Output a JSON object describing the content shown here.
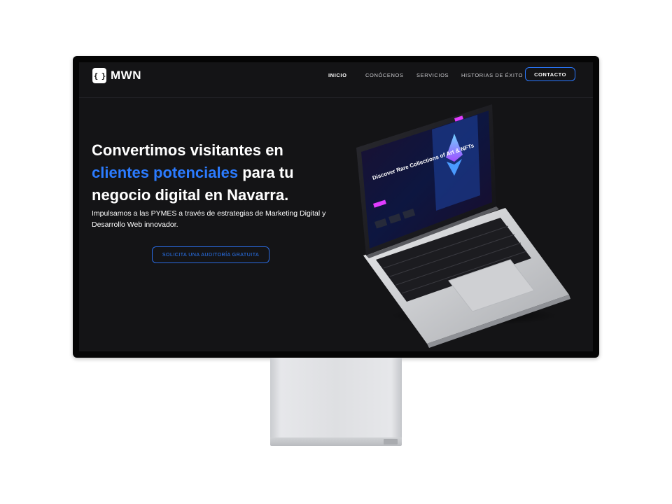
{
  "brand": {
    "logo_glyph": "{ }",
    "name": "MWN"
  },
  "nav": {
    "items": [
      {
        "label": "INICIO",
        "active": true
      },
      {
        "label": "CONÓCENOS",
        "active": false
      },
      {
        "label": "SERVICIOS",
        "active": false
      },
      {
        "label": "HISTORIAS DE ÉXITO",
        "active": false
      }
    ],
    "cta": "CONTACTO"
  },
  "hero": {
    "title_line1": "Convertimos visitantes en",
    "title_accent": "clientes potenciales",
    "title_line2_rest": " para tu",
    "title_line3": "negocio digital en Navarra.",
    "subtitle": "Impulsamos a las PYMES a través de estrategias de Marketing Digital y Desarrollo Web innovador.",
    "cta": "SOLICITA UNA AUDITORÍA GRATUITA"
  },
  "laptop_screen": {
    "headline": "Discover Rare Collections of Art & NFTs"
  },
  "colors": {
    "accent": "#2b7bff",
    "background": "#141416",
    "text": "#ffffff"
  }
}
